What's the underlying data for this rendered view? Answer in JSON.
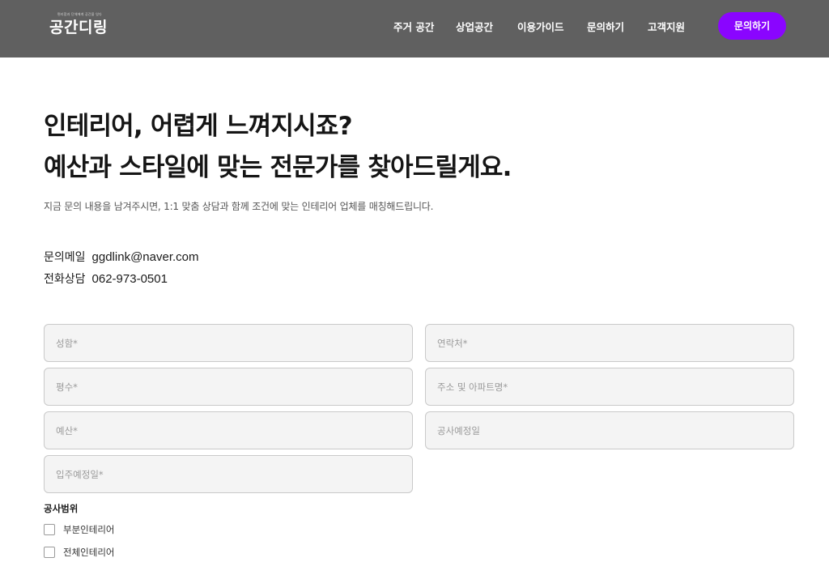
{
  "header": {
    "logo": {
      "tagline": "편리함과 단체에게 공간을 잇다",
      "text": "공간디링"
    },
    "nav": [
      "주거 공간",
      "상업공간",
      "이용가이드",
      "문의하기",
      "고객지원"
    ],
    "cta_label": "문의하기",
    "cta_color": "#8a05ff"
  },
  "hero": {
    "headline_line1": "인테리어, 어렵게 느껴지시죠?",
    "headline_line2": "예산과 스타일에 맞는 전문가를 찾아드릴게요.",
    "subtext": "지금 문의 내용을 남겨주시면, 1:1 맞춤 상담과 함께 조건에 맞는 인테리어 업체를 매칭해드립니다."
  },
  "contact": {
    "email_label": "문의메일",
    "email_value": "ggdlink@naver.com",
    "phone_label": "전화상담",
    "phone_value": "062-973-0501"
  },
  "form": {
    "fields": {
      "name": "성함*",
      "phone": "연락처*",
      "area": "평수*",
      "address": "주소 및 아파트명*",
      "budget": "예산*",
      "construction_date": "공사예정일",
      "move_in_date": "입주예정일*"
    },
    "scope_label": "공사범위",
    "scope_options": [
      "부분인테리어",
      "전체인테리어"
    ]
  }
}
